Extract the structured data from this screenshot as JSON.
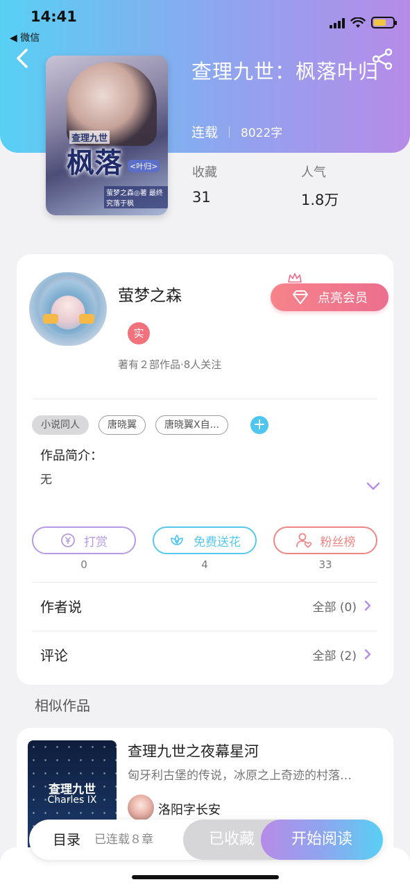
{
  "status_bar": {
    "time": "14:41",
    "back_app": "◀ 微信"
  },
  "book": {
    "title": "查理九世：枫落叶归",
    "status": "连载",
    "word_count": "8022字",
    "cover_text": {
      "small": "查理九世",
      "big": "枫落",
      "tag": "<叶归>",
      "sub": "萤梦之森◎著 最终究落于枫"
    },
    "stats": [
      {
        "label": "收藏",
        "value": "31"
      },
      {
        "label": "人气",
        "value": "1.8万"
      }
    ]
  },
  "author": {
    "name": "萤梦之森",
    "badge": "实",
    "stats": "著有２部作品·8人关注",
    "vip_button": "点亮会员"
  },
  "tags": [
    "小说同人",
    "唐晓翼",
    "唐晓翼X自..."
  ],
  "intro": {
    "label": "作品简介：",
    "text": "无"
  },
  "actions": [
    {
      "label": "打赏",
      "count": "0",
      "color": "#b79ae6",
      "icon": "yen-coin-icon"
    },
    {
      "label": "免费送花",
      "count": "4",
      "color": "#55c8ee",
      "icon": "flower-icon"
    },
    {
      "label": "粉丝榜",
      "count": "33",
      "color": "#ef8585",
      "icon": "fan-rank-icon"
    }
  ],
  "rows": [
    {
      "title": "作者说",
      "right": "全部 (0)"
    },
    {
      "title": "评论",
      "right": "全部 (2)"
    }
  ],
  "similar": {
    "section_title": "相似作品",
    "items": [
      {
        "title": "查理九世之夜幕星河",
        "desc": "匈牙利古堡的传说，冰原之上奇迹的村落…",
        "author": "洛阳字长安",
        "cover_zh": "查理九世",
        "cover_en": "Charles IX"
      }
    ]
  },
  "bottom_bar": {
    "toc": "目录",
    "toc_count": "已连载８章",
    "favorited": "已收藏",
    "start_reading": "开始阅读"
  },
  "colors": {
    "accent_start": "#58d0f4",
    "accent_end": "#b68be8",
    "vip": "#f06c88"
  }
}
